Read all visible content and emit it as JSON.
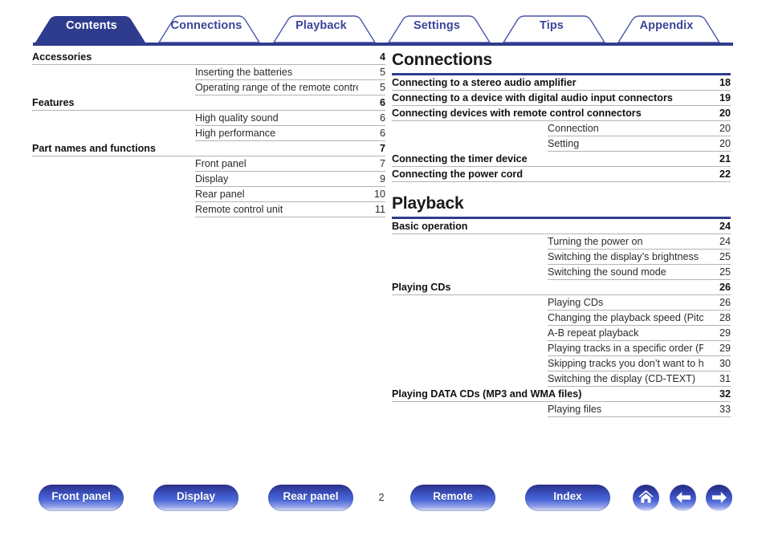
{
  "tabs": [
    {
      "label": "Contents",
      "active": true
    },
    {
      "label": "Connections",
      "active": false
    },
    {
      "label": "Playback",
      "active": false
    },
    {
      "label": "Settings",
      "active": false
    },
    {
      "label": "Tips",
      "active": false
    },
    {
      "label": "Appendix",
      "active": false
    }
  ],
  "left_column": {
    "entries": [
      {
        "level": 1,
        "title": "Accessories",
        "page": "4"
      },
      {
        "level": 2,
        "title": "Inserting the batteries",
        "page": "5"
      },
      {
        "level": 2,
        "title": "Operating range of the remote control unit",
        "page": "5"
      },
      {
        "level": 1,
        "title": "Features",
        "page": "6"
      },
      {
        "level": 2,
        "title": "High quality sound",
        "page": "6"
      },
      {
        "level": 2,
        "title": "High performance",
        "page": "6"
      },
      {
        "level": 1,
        "title": "Part names and functions",
        "page": "7"
      },
      {
        "level": 2,
        "title": "Front panel",
        "page": "7"
      },
      {
        "level": 2,
        "title": "Display",
        "page": "9"
      },
      {
        "level": 2,
        "title": "Rear panel",
        "page": "10"
      },
      {
        "level": 2,
        "title": "Remote control unit",
        "page": "11"
      }
    ]
  },
  "right_column": {
    "sections": [
      {
        "heading": "Connections",
        "entries": [
          {
            "level": 1,
            "title": "Connecting to a stereo audio amplifier",
            "page": "18"
          },
          {
            "level": 1,
            "title": "Connecting to a device with digital audio input connectors",
            "page": "19"
          },
          {
            "level": 1,
            "title": "Connecting devices with remote control connectors",
            "page": "20"
          },
          {
            "level": 2,
            "title": "Connection",
            "page": "20"
          },
          {
            "level": 2,
            "title": "Setting",
            "page": "20"
          },
          {
            "level": 1,
            "title": "Connecting the timer device",
            "page": "21"
          },
          {
            "level": 1,
            "title": "Connecting the power cord",
            "page": "22"
          }
        ]
      },
      {
        "heading": "Playback",
        "entries": [
          {
            "level": 1,
            "title": "Basic operation",
            "page": "24"
          },
          {
            "level": 2,
            "title": "Turning the power on",
            "page": "24"
          },
          {
            "level": 2,
            "title": "Switching the display’s brightness",
            "page": "25"
          },
          {
            "level": 2,
            "title": "Switching the sound mode",
            "page": "25"
          },
          {
            "level": 1,
            "title": "Playing CDs",
            "page": "26"
          },
          {
            "level": 2,
            "title": "Playing CDs",
            "page": "26"
          },
          {
            "level": 2,
            "title": "Changing the playback speed (Pitch control playback)",
            "page": "28"
          },
          {
            "level": 2,
            "title": "A-B repeat playback",
            "page": "29"
          },
          {
            "level": 2,
            "title": "Playing tracks in a specific order (Program playback)",
            "page": "29"
          },
          {
            "level": 2,
            "title": "Skipping tracks you don’t want to hear (Delete program playback)",
            "page": "30"
          },
          {
            "level": 2,
            "title": "Switching the display (CD-TEXT)",
            "page": "31"
          },
          {
            "level": 1,
            "title": "Playing DATA CDs (MP3 and WMA files)",
            "page": "32"
          },
          {
            "level": 2,
            "title": "Playing files",
            "page": "33"
          }
        ]
      }
    ]
  },
  "footer": {
    "buttons": [
      {
        "label": "Front panel"
      },
      {
        "label": "Display"
      },
      {
        "label": "Rear panel"
      },
      {
        "label": "Remote"
      },
      {
        "label": "Index"
      }
    ],
    "page_number": "2",
    "icons": [
      {
        "name": "home-icon"
      },
      {
        "name": "arrow-left-icon"
      },
      {
        "name": "arrow-right-icon"
      }
    ]
  },
  "colors": {
    "brand_navy": "#2f3c8e",
    "tab_active_fill": "#2f3c8e",
    "tab_inactive_text": "#3a4698",
    "rule_gray": "#b3b3b3",
    "text": "#1a1a1a"
  }
}
